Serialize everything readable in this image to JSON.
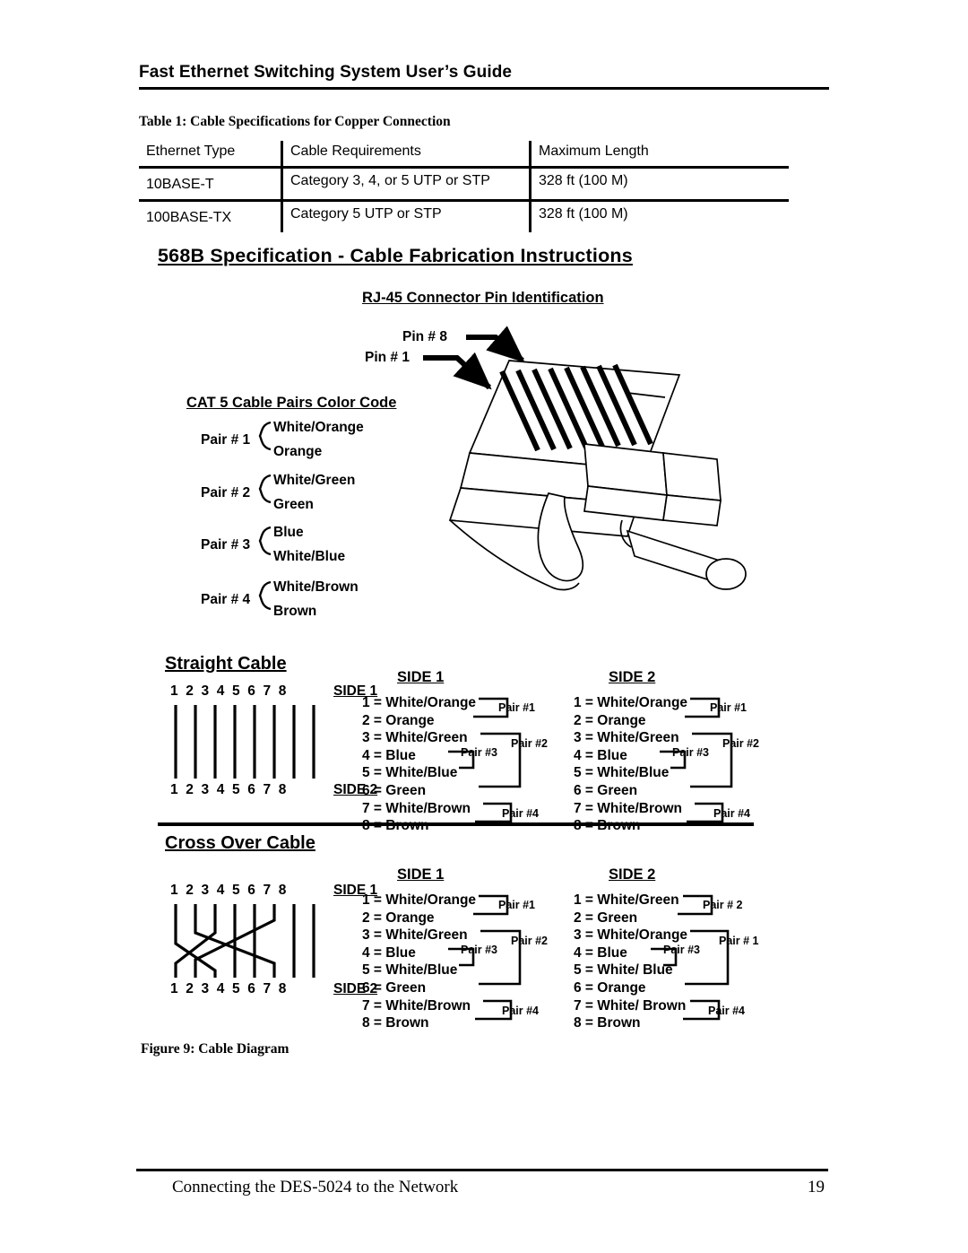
{
  "header": {
    "title": "Fast Ethernet Switching System User’s Guide"
  },
  "table": {
    "caption": "Table 1: Cable Specifications for Copper Connection",
    "columns": [
      "Ethernet Type",
      "Cable Requirements",
      "Maximum Length"
    ],
    "rows": [
      {
        "ethernet_type": "10BASE-T",
        "cable_requirements": "Category 3, 4, or 5 UTP or STP",
        "maximum_length": "328 ft (100 M)"
      },
      {
        "ethernet_type": "100BASE-TX",
        "cable_requirements": "Category 5 UTP or STP",
        "maximum_length": "328 ft (100 M)"
      }
    ]
  },
  "figure": {
    "caption": "Figure 9: Cable Diagram",
    "main_title": "568B Specification - Cable Fabrication Instructions",
    "connector": {
      "title": "RJ-45 Connector Pin Identification",
      "pin_top_label": "Pin # 8",
      "pin_bottom_label": "Pin # 1"
    },
    "color_code": {
      "title": "CAT 5 Cable Pairs Color Code",
      "pairs": [
        {
          "label": "Pair # 1",
          "wires": [
            "White/Orange",
            "Orange"
          ]
        },
        {
          "label": "Pair # 2",
          "wires": [
            "White/Green",
            "Green"
          ]
        },
        {
          "label": "Pair # 3",
          "wires": [
            "Blue",
            "White/Blue"
          ]
        },
        {
          "label": "Pair # 4",
          "wires": [
            "White/Brown",
            "Brown"
          ]
        }
      ]
    },
    "straight_cable": {
      "title": "Straight Cable",
      "pin_numbers": [
        "1",
        "2",
        "3",
        "4",
        "5",
        "6",
        "7",
        "8"
      ],
      "side1_tag": "SIDE 1",
      "side2_tag": "SIDE 2",
      "mapping": [
        {
          "from": 1,
          "to": 1
        },
        {
          "from": 2,
          "to": 2
        },
        {
          "from": 3,
          "to": 3
        },
        {
          "from": 4,
          "to": 4
        },
        {
          "from": 5,
          "to": 5
        },
        {
          "from": 6,
          "to": 6
        },
        {
          "from": 7,
          "to": 7
        },
        {
          "from": 8,
          "to": 8
        }
      ],
      "side1": {
        "title": "SIDE 1",
        "wires": [
          "1 = White/Orange",
          "2 = Orange",
          "3 = White/Green",
          "4 = Blue",
          "5 = White/Blue",
          "6 = Green",
          "7 = White/Brown",
          "8 = Brown"
        ],
        "pair_tags": [
          "Pair #1",
          "Pair #2",
          "Pair #3",
          "Pair #4"
        ]
      },
      "side2": {
        "title": "SIDE 2",
        "wires": [
          "1 = White/Orange",
          "2 = Orange",
          "3 = White/Green",
          "4 = Blue",
          "5 = White/Blue",
          "6 = Green",
          "7 = White/Brown",
          "8 = Brown"
        ],
        "pair_tags": [
          "Pair #1",
          "Pair #2",
          "Pair #3",
          "Pair #4"
        ]
      }
    },
    "crossover_cable": {
      "title": "Cross Over Cable",
      "pin_numbers": [
        "1",
        "2",
        "3",
        "4",
        "5",
        "6",
        "7",
        "8"
      ],
      "side1_tag": "SIDE 1",
      "side2_tag": "SIDE 2",
      "mapping": [
        {
          "from": 1,
          "to": 3
        },
        {
          "from": 2,
          "to": 6
        },
        {
          "from": 3,
          "to": 1
        },
        {
          "from": 4,
          "to": 4
        },
        {
          "from": 5,
          "to": 5
        },
        {
          "from": 6,
          "to": 2
        },
        {
          "from": 7,
          "to": 7
        },
        {
          "from": 8,
          "to": 8
        }
      ],
      "side1": {
        "title": "SIDE 1",
        "wires": [
          "1 = White/Orange",
          "2 = Orange",
          "3 = White/Green",
          "4 = Blue",
          "5 = White/Blue",
          "6 = Green",
          "7 = White/Brown",
          "8 = Brown"
        ],
        "pair_tags": [
          "Pair #1",
          "Pair #2",
          "Pair #3",
          "Pair #4"
        ]
      },
      "side2": {
        "title": "SIDE 2",
        "wires": [
          "1 = White/Green",
          "2 = Green",
          "3 = White/Orange",
          "4 = Blue",
          "5 = White/ Blue",
          "6 = Orange",
          "7 = White/ Brown",
          "8 = Brown"
        ],
        "pair_tags": [
          "Pair # 2",
          "Pair # 1",
          "Pair #3",
          "Pair #4"
        ]
      }
    }
  },
  "footer": {
    "text": "Connecting the DES-5024 to the Network",
    "page_number": "19"
  }
}
